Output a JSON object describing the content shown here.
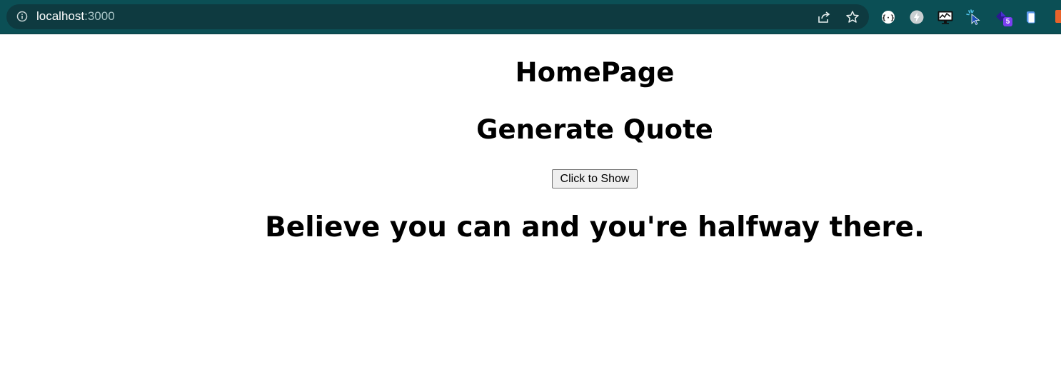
{
  "browser": {
    "url_host": "localhost",
    "url_port": ":3000",
    "colors": {
      "toolbar": "#0b4f55",
      "omnibox": "#0e3a40"
    },
    "omnibox_actions": [
      {
        "icon": "share-icon"
      },
      {
        "icon": "star-icon"
      }
    ],
    "extensions": [
      {
        "icon": "json-viewer-icon"
      },
      {
        "icon": "lightning-icon"
      },
      {
        "icon": "monitor-chart-icon"
      },
      {
        "icon": "cursor-sparkle-icon"
      },
      {
        "icon": "purple-gem-icon",
        "badge": "5"
      },
      {
        "icon": "clipboard-icon"
      }
    ]
  },
  "page": {
    "title": "HomePage",
    "subtitle": "Generate Quote",
    "button_label": "Click to Show",
    "quote": "Believe you can and you're halfway there."
  }
}
